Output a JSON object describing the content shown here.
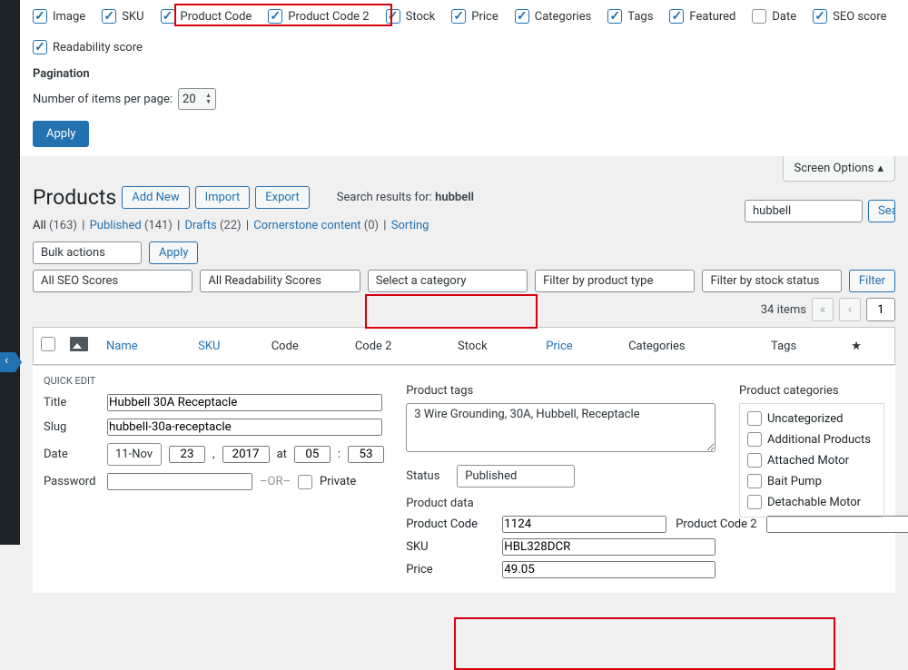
{
  "columns": {
    "image": "Image",
    "sku": "SKU",
    "product_code": "Product Code",
    "product_code_2": "Product Code 2",
    "stock": "Stock",
    "price": "Price",
    "categories": "Categories",
    "tags": "Tags",
    "featured": "Featured",
    "date": "Date",
    "seo_score": "SEO score",
    "readability_score": "Readability score"
  },
  "pagination_section": "Pagination",
  "per_page_label": "Number of items per page:",
  "per_page_value": "20",
  "apply_label": "Apply",
  "screen_options_tab": "Screen Options",
  "page_title": "Products",
  "add_new": "Add New",
  "import": "Import",
  "export": "Export",
  "search_results_label": "Search results for:",
  "search_term": "hubbell",
  "search_button": "Search",
  "status_links": {
    "all": "All",
    "all_count": "(163)",
    "published": "Published",
    "published_count": "(141)",
    "drafts": "Drafts",
    "drafts_count": "(22)",
    "cornerstone": "Cornerstone content",
    "cornerstone_count": "(0)",
    "sorting": "Sorting"
  },
  "bulk_actions": "Bulk actions",
  "filters": {
    "seo": "All SEO Scores",
    "readability": "All Readability Scores",
    "category": "Select a category",
    "product_type": "Filter by product type",
    "stock_status": "Filter by stock status"
  },
  "filter_button": "Filter",
  "items_count": "34 items",
  "current_page": "1",
  "table_headers": {
    "name": "Name",
    "sku": "SKU",
    "code": "Code",
    "code2": "Code 2",
    "stock": "Stock",
    "price": "Price",
    "categories": "Categories",
    "tags": "Tags"
  },
  "quick_edit": {
    "heading": "QUICK EDIT",
    "title_label": "Title",
    "title_value": "Hubbell 30A Receptacle",
    "slug_label": "Slug",
    "slug_value": "hubbell-30a-receptacle",
    "date_label": "Date",
    "month": "11-Nov",
    "day": "23",
    "year": "2017",
    "at": "at",
    "hour": "05",
    "minute": "53",
    "password_label": "Password",
    "or": "–OR–",
    "private": "Private",
    "product_tags_heading": "Product tags",
    "product_tags_value": "3 Wire Grounding, 30A, Hubbell, Receptacle",
    "status_label": "Status",
    "status_value": "Published",
    "product_data_heading": "Product data",
    "product_code_label": "Product Code",
    "product_code_value": "1124",
    "product_code_2_label": "Product Code 2",
    "product_code_2_value": "",
    "sku_label": "SKU",
    "sku_value": "HBL328DCR",
    "price_label": "Price",
    "price_value": "49.05",
    "product_categories_heading": "Product categories",
    "categories": [
      "Uncategorized",
      "Additional Products",
      "Attached Motor",
      "Bait Pump",
      "Detachable Motor"
    ]
  }
}
